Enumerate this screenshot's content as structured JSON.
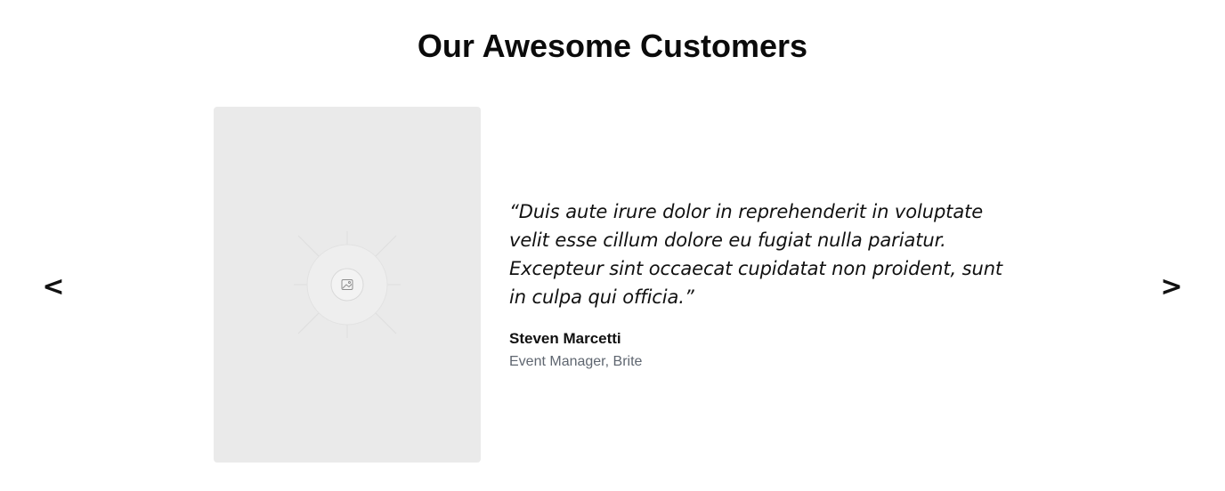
{
  "section": {
    "title": "Our Awesome Customers"
  },
  "carousel": {
    "prev_label": "<",
    "next_label": ">"
  },
  "testimonial": {
    "image_icon": "image-placeholder-icon",
    "quote": "“Duis aute irure dolor in reprehenderit in voluptate velit esse cillum dolore eu fugiat nulla pariatur. Excepteur sint occaecat cupidatat non proident, sunt in culpa qui officia.”",
    "author": "Steven Marcetti",
    "role": "Event Manager, Brite"
  },
  "colors": {
    "placeholder_bg": "#eaeaea",
    "role_text": "#5f6670"
  }
}
